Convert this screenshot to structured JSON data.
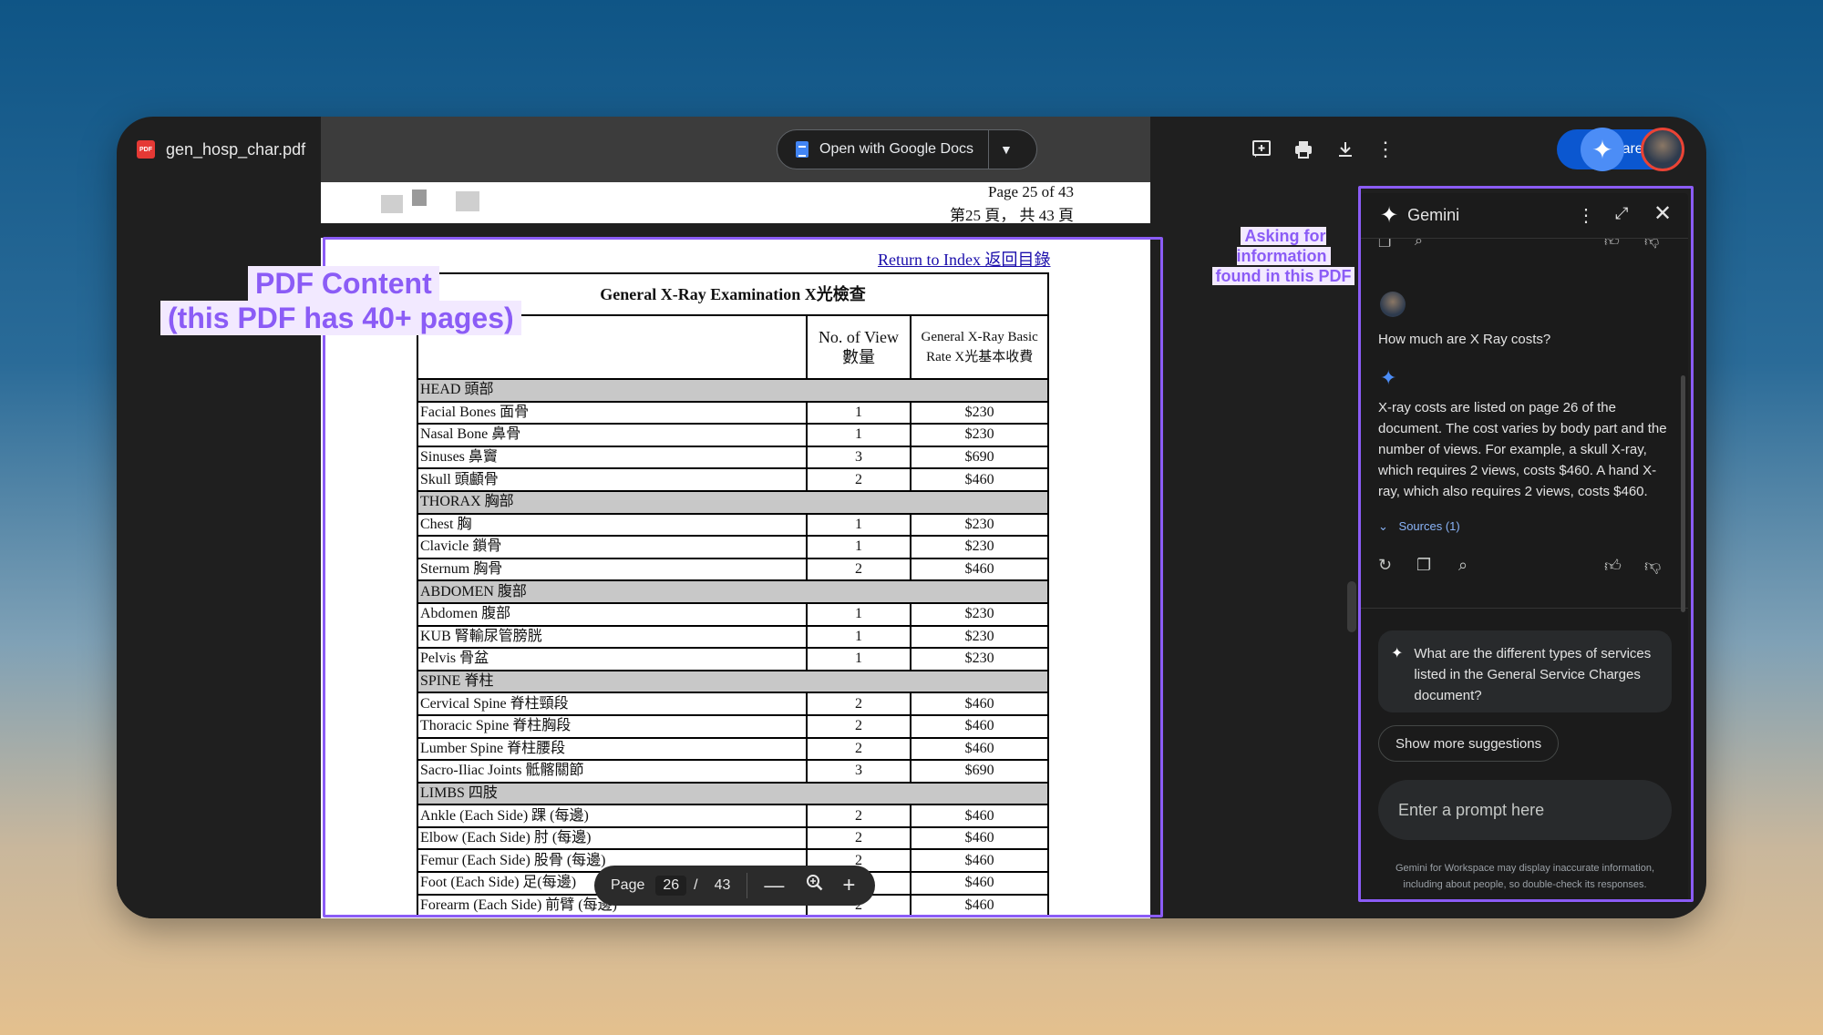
{
  "file": {
    "badge": "PDF",
    "name": "gen_hosp_char.pdf"
  },
  "toolbar": {
    "open_with_label": "Open with Google Docs",
    "share_label": "Share",
    "icons": [
      "add-comment-icon",
      "print-icon",
      "download-icon",
      "more-vert-icon"
    ]
  },
  "page_header": {
    "line1": "Page 25 of 43",
    "line2": "第25 頁， 共 43 頁"
  },
  "pdf": {
    "return_link": "Return to Index 返回目錄",
    "table_title": "General X-Ray Examination  X光檢查",
    "col_views": "No. of View 數量",
    "col_rate": "General X-Ray Basic Rate X光基本收費",
    "rows": [
      {
        "section": "HEAD 頭部"
      },
      {
        "name": "Facial Bones 面骨",
        "views": "1",
        "rate": "$230"
      },
      {
        "name": "Nasal Bone 鼻骨",
        "views": "1",
        "rate": "$230"
      },
      {
        "name": "Sinuses 鼻竇",
        "views": "3",
        "rate": "$690"
      },
      {
        "name": "Skull 頭顱骨",
        "views": "2",
        "rate": "$460"
      },
      {
        "section": "THORAX  胸部"
      },
      {
        "name": "Chest 胸",
        "views": "1",
        "rate": "$230"
      },
      {
        "name": "Clavicle 鎖骨",
        "views": "1",
        "rate": "$230"
      },
      {
        "name": "Sternum 胸骨",
        "views": "2",
        "rate": "$460"
      },
      {
        "section": "ABDOMEN 腹部"
      },
      {
        "name": "Abdomen 腹部",
        "views": "1",
        "rate": "$230"
      },
      {
        "name": "KUB 腎輸尿管膀胱",
        "views": "1",
        "rate": "$230"
      },
      {
        "name": "Pelvis 骨盆",
        "views": "1",
        "rate": "$230"
      },
      {
        "section": "SPINE  脊柱"
      },
      {
        "name": "Cervical Spine 脊柱頸段",
        "views": "2",
        "rate": "$460"
      },
      {
        "name": "Thoracic Spine 脊柱胸段",
        "views": "2",
        "rate": "$460"
      },
      {
        "name": "Lumber Spine 脊柱腰段",
        "views": "2",
        "rate": "$460"
      },
      {
        "name": "Sacro-Iliac Joints 骶髂關節",
        "views": "3",
        "rate": "$690"
      },
      {
        "section": "LIMBS 四肢"
      },
      {
        "name": "Ankle (Each Side) 踝 (每邊)",
        "views": "2",
        "rate": "$460"
      },
      {
        "name": "Elbow (Each Side) 肘 (每邊)",
        "views": "2",
        "rate": "$460"
      },
      {
        "name": "Femur (Each Side) 股骨 (每邊)",
        "views": "2",
        "rate": "$460"
      },
      {
        "name": "Foot (Each Side) 足(每邊)",
        "views": "2",
        "rate": "$460"
      },
      {
        "name": "Forearm (Each Side) 前臂 (每邊)",
        "views": "2",
        "rate": "$460"
      }
    ]
  },
  "page_toolbar": {
    "label": "Page",
    "current": "26",
    "slash": "/",
    "total": "43"
  },
  "gemini": {
    "title": "Gemini",
    "question": "How much are X Ray costs?",
    "answer": "X-ray costs are listed on page 26 of the document. The cost varies by body part and the number of views. For example, a skull X-ray, which requires 2 views, costs $460. A hand X-ray, which also requires 2 views, costs $460.",
    "sources": "Sources (1)",
    "suggestion": "What are the different types of services listed in the General Service Charges document?",
    "more_suggestions": "Show more suggestions",
    "prompt_placeholder": "Enter a prompt here",
    "disclaimer": "Gemini for Workspace may display inaccurate information, including about people, so double-check its responses."
  },
  "annotations": {
    "pdf_line1": "PDF Content",
    "pdf_line2": "(this PDF has 40+ pages)",
    "gemini_line1": "Asking for information",
    "gemini_line2": "found in this PDF",
    "color": "#8b5cf6"
  }
}
